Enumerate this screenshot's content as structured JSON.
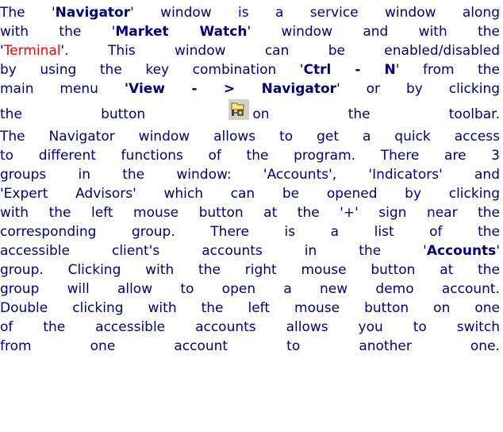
{
  "lines": {
    "l1": {
      "a": "The '",
      "b": "Navigator",
      "c": "' window is a service window along"
    },
    "l2": {
      "a": "with the '",
      "b": "Market Watch",
      "c": "' window and with the"
    },
    "l3": {
      "a": "'",
      "b": "Terminal",
      "c": "'. This window can be enabled/disabled"
    },
    "l4": {
      "a": "by using the key combination '",
      "b": "Ctrl - N",
      "c": "' from the"
    },
    "l5": {
      "a": "main menu ",
      "b": "'View - > Navigator",
      "c": "' or by clicking"
    },
    "l6": {
      "a": "the",
      "b": "button",
      "c": "on",
      "d": "the",
      "e": "toolbar."
    },
    "l7": "The Navigator window allows to get a quick access",
    "l8": "to different functions of the program. There are 3",
    "l9": "groups in the window: 'Accounts', 'Indicators' and",
    "l10": "'Expert Advisors' which can be opened by clicking",
    "l11": "with the left mouse button at the '+' sign near the",
    "l12": "corresponding group. There is a list of the",
    "l13": {
      "a": "accessible client's accounts in the '",
      "b": "Accounts",
      "c": "'"
    },
    "l14": "group. Clicking with the right mouse button at the",
    "l15": "group will allow to open a new demo account.",
    "l16": "Double clicking with the left mouse button on one",
    "l17": "of the accessible accounts allows you to switch",
    "l18": {
      "a": "from",
      "b": "one",
      "c": "account",
      "d": "to",
      "e": "another",
      "f": "one."
    }
  },
  "colors": {
    "text": "#000080",
    "highlight": "#ff0000"
  },
  "icons": {
    "toolbar_button": "navigator-icon"
  }
}
